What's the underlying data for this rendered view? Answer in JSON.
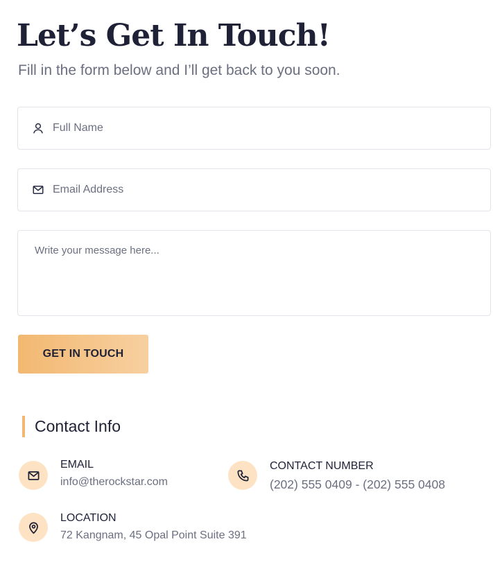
{
  "header": {
    "title": "Let’s Get In Touch!",
    "subtitle": "Fill in the form below and I’ll get back to you soon."
  },
  "form": {
    "name_placeholder": "Full Name",
    "email_placeholder": "Email Address",
    "message_placeholder": "Write your message here...",
    "submit_label": "GET IN TOUCH"
  },
  "contact": {
    "heading": "Contact Info",
    "email": {
      "label": "EMAIL",
      "value": "info@therockstar.com",
      "icon": "mail-icon"
    },
    "phone": {
      "label": "CONTACT NUMBER",
      "value": "(202) 555 0409 - (202) 555 0408",
      "icon": "phone-icon"
    },
    "location": {
      "label": "LOCATION",
      "value": "72 Kangnam, 45 Opal Point Suite 391",
      "icon": "map-pin-icon"
    }
  },
  "colors": {
    "accent": "#f2b871",
    "accent_light": "#fde3c3",
    "text_dark": "#1f2136",
    "text_muted": "#6b6f80",
    "border": "#e3e3ea"
  }
}
